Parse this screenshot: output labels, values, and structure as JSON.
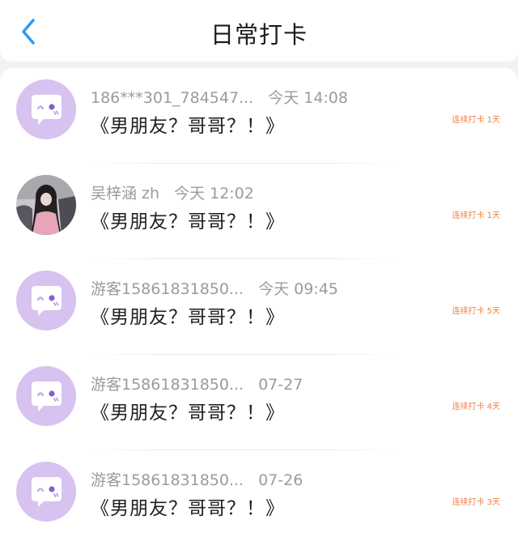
{
  "header": {
    "title": "日常打卡",
    "back_icon": "chevron-left-icon",
    "accent_color": "#2f9bf2"
  },
  "entries": [
    {
      "username": "186***301_784547...",
      "time": "今天 14:08",
      "content": "《男朋友？哥哥？！》",
      "streak": "连续打卡 1天",
      "avatar": "chat-bubble-default-avatar"
    },
    {
      "username": "吴梓涵 zh",
      "time": "今天 12:02",
      "content": "《男朋友？哥哥？！》",
      "streak": "连续打卡 1天",
      "avatar": "user-photo-avatar"
    },
    {
      "username": "游客15861831850...",
      "time": "今天 09:45",
      "content": "《男朋友？哥哥？！》",
      "streak": "连续打卡 5天",
      "avatar": "chat-bubble-default-avatar"
    },
    {
      "username": "游客15861831850...",
      "time": "07-27",
      "content": "《男朋友？哥哥？！》",
      "streak": "连续打卡 4天",
      "avatar": "chat-bubble-default-avatar"
    },
    {
      "username": "游客15861831850...",
      "time": "07-26",
      "content": "《男朋友？哥哥？！》",
      "streak": "连续打卡 3天",
      "avatar": "chat-bubble-default-avatar"
    }
  ],
  "colors": {
    "avatar_bg": "#d7c2f0",
    "streak": "#f07f3c",
    "meta": "#9b9b9b"
  }
}
